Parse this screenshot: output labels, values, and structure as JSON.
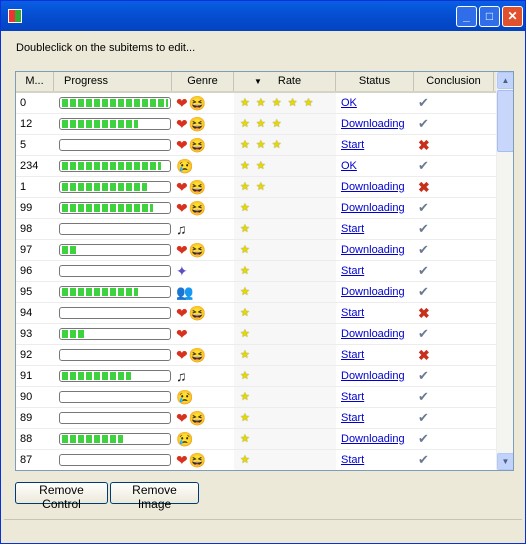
{
  "window": {
    "title": "",
    "buttons": {
      "minimize": "_",
      "maximize": "□",
      "close": "✕"
    }
  },
  "instruction": "Doubleclick on the subitems to edit...",
  "columns": [
    "M...",
    "Progress",
    "Genre",
    "Rate",
    "Status",
    "Conclusion"
  ],
  "sort_column": "Rate",
  "rows": [
    {
      "m": "0",
      "progress": 100,
      "genre": [
        "heart",
        "laugh"
      ],
      "rate": 5,
      "status": "OK",
      "ok": true
    },
    {
      "m": "12",
      "progress": 72,
      "genre": [
        "heart",
        "laugh"
      ],
      "rate": 3,
      "status": "Downloading",
      "ok": true
    },
    {
      "m": "5",
      "progress": 0,
      "genre": [
        "heart",
        "laugh"
      ],
      "rate": 3,
      "status": "Start",
      "ok": false
    },
    {
      "m": "234",
      "progress": 93,
      "genre": [
        "cry"
      ],
      "rate": 2,
      "status": "OK",
      "ok": true
    },
    {
      "m": "1",
      "progress": 80,
      "genre": [
        "heart",
        "laugh"
      ],
      "rate": 2,
      "status": "Downloading",
      "ok": false
    },
    {
      "m": "99",
      "progress": 86,
      "genre": [
        "heart",
        "laugh"
      ],
      "rate": 1,
      "status": "Downloading",
      "ok": true
    },
    {
      "m": "98",
      "progress": 0,
      "genre": [
        "music"
      ],
      "rate": 1,
      "status": "Start",
      "ok": true
    },
    {
      "m": "97",
      "progress": 15,
      "genre": [
        "heart",
        "laugh"
      ],
      "rate": 1,
      "status": "Downloading",
      "ok": true
    },
    {
      "m": "96",
      "progress": 0,
      "genre": [
        "image"
      ],
      "rate": 1,
      "status": "Start",
      "ok": true
    },
    {
      "m": "95",
      "progress": 72,
      "genre": [
        "people"
      ],
      "rate": 1,
      "status": "Downloading",
      "ok": true
    },
    {
      "m": "94",
      "progress": 0,
      "genre": [
        "heart",
        "laugh"
      ],
      "rate": 1,
      "status": "Start",
      "ok": false
    },
    {
      "m": "93",
      "progress": 22,
      "genre": [
        "heart"
      ],
      "rate": 1,
      "status": "Downloading",
      "ok": true
    },
    {
      "m": "92",
      "progress": 0,
      "genre": [
        "heart",
        "laugh"
      ],
      "rate": 1,
      "status": "Start",
      "ok": false
    },
    {
      "m": "91",
      "progress": 65,
      "genre": [
        "music"
      ],
      "rate": 1,
      "status": "Downloading",
      "ok": true
    },
    {
      "m": "90",
      "progress": 0,
      "genre": [
        "cry"
      ],
      "rate": 1,
      "status": "Start",
      "ok": true
    },
    {
      "m": "89",
      "progress": 0,
      "genre": [
        "heart",
        "laugh"
      ],
      "rate": 1,
      "status": "Start",
      "ok": true
    },
    {
      "m": "88",
      "progress": 58,
      "genre": [
        "cry"
      ],
      "rate": 1,
      "status": "Downloading",
      "ok": true
    },
    {
      "m": "87",
      "progress": 0,
      "genre": [
        "heart",
        "laugh"
      ],
      "rate": 1,
      "status": "Start",
      "ok": true
    }
  ],
  "buttons": {
    "remove_control": "Remove Control",
    "remove_image": "Remove Image"
  },
  "colors": {
    "titlebar": "#0550d4",
    "progress": "#3fd23f",
    "link": "#0000cc",
    "star": "#e6d800"
  }
}
